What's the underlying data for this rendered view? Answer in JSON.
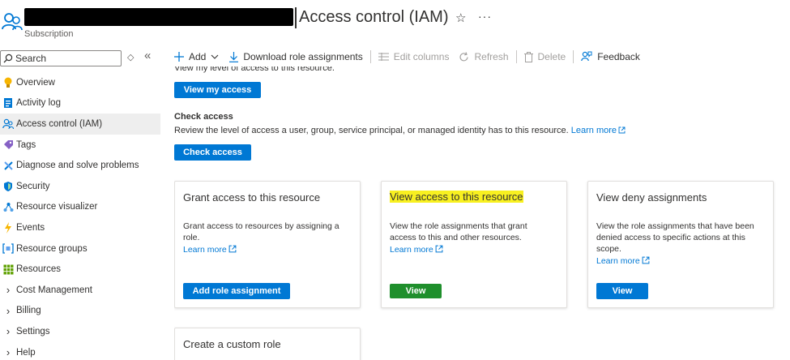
{
  "header": {
    "title": "Access control (IAM)",
    "subtitle": "Subscription",
    "favorite_icon": "star-icon",
    "more_icon": "ellipsis-icon"
  },
  "sidebar": {
    "search_placeholder": "Search",
    "items": [
      {
        "label": "Overview",
        "icon": "lightbulb-icon"
      },
      {
        "label": "Activity log",
        "icon": "log-icon"
      },
      {
        "label": "Access control (IAM)",
        "icon": "people-icon",
        "active": true
      },
      {
        "label": "Tags",
        "icon": "tag-icon"
      },
      {
        "label": "Diagnose and solve problems",
        "icon": "wrench-icon"
      },
      {
        "label": "Security",
        "icon": "shield-icon"
      },
      {
        "label": "Resource visualizer",
        "icon": "network-icon"
      },
      {
        "label": "Events",
        "icon": "bolt-icon"
      },
      {
        "label": "Resource groups",
        "icon": "resource-group-icon"
      },
      {
        "label": "Resources",
        "icon": "grid-icon"
      },
      {
        "label": "Cost Management",
        "icon": "chevron-right-icon"
      },
      {
        "label": "Billing",
        "icon": "chevron-right-icon"
      },
      {
        "label": "Settings",
        "icon": "chevron-right-icon"
      },
      {
        "label": "Help",
        "icon": "chevron-right-icon"
      }
    ]
  },
  "toolbar": {
    "add": "Add",
    "download": "Download role assignments",
    "edit_columns": "Edit columns",
    "refresh": "Refresh",
    "delete": "Delete",
    "feedback": "Feedback"
  },
  "content": {
    "cut_text": "View my level of access to this resource.",
    "view_my_access": "View my access",
    "check_access_title": "Check access",
    "check_access_desc": "Review the level of access a user, group, service principal, or managed identity has to this resource.",
    "learn_more": "Learn more",
    "check_access_button": "Check access",
    "cards": [
      {
        "title": "Grant access to this resource",
        "desc": "Grant access to resources by assigning a role.",
        "link": "Learn more",
        "button": "Add role assignment"
      },
      {
        "title": "View access to this resource",
        "desc": "View the role assignments that grant access to this and other resources.",
        "link": "Learn more",
        "button": "View"
      },
      {
        "title": "View deny assignments",
        "desc": "View the role assignments that have been denied access to specific actions at this scope.",
        "link": "Learn more",
        "button": "View"
      },
      {
        "title": "Create a custom role"
      }
    ]
  },
  "colors": {
    "accent": "#0078d4",
    "highlight": "#f8f020",
    "highlight_button": "#1f8f2c",
    "text": "#323130"
  }
}
